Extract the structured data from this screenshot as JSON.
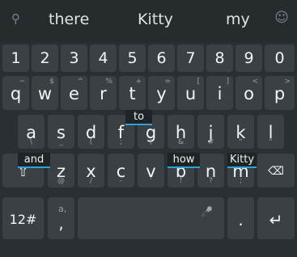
{
  "suggestions": {
    "search_icon": "search-icon",
    "items": [
      "there",
      "Kitty",
      "my"
    ],
    "emoji_icon": "emoji-icon"
  },
  "number_row": [
    {
      "main": "1",
      "alt": ""
    },
    {
      "main": "2",
      "alt": ""
    },
    {
      "main": "3",
      "alt": ""
    },
    {
      "main": "4",
      "alt": ""
    },
    {
      "main": "5",
      "alt": ""
    },
    {
      "main": "6",
      "alt": ""
    },
    {
      "main": "7",
      "alt": ""
    },
    {
      "main": "8",
      "alt": ""
    },
    {
      "main": "9",
      "alt": ""
    },
    {
      "main": "0",
      "alt": ""
    }
  ],
  "row1": [
    {
      "main": "q",
      "alt": "~"
    },
    {
      "main": "w",
      "alt": "$"
    },
    {
      "main": "e",
      "alt": "^"
    },
    {
      "main": "r",
      "alt": "%"
    },
    {
      "main": "t",
      "alt": "+"
    },
    {
      "main": "y",
      "alt": "="
    },
    {
      "main": "u",
      "alt": "["
    },
    {
      "main": "i",
      "alt": "]"
    },
    {
      "main": "o",
      "alt": "<"
    },
    {
      "main": "p",
      "alt": ">"
    }
  ],
  "row2": [
    {
      "main": "a",
      "alt": "\\"
    },
    {
      "main": "s",
      "alt": "_"
    },
    {
      "main": "d",
      "alt": "("
    },
    {
      "main": "f",
      "alt": ";"
    },
    {
      "main": "g",
      "alt": ")"
    },
    {
      "main": "h",
      "alt": "&"
    },
    {
      "main": "j",
      "alt": "#"
    },
    {
      "main": "k",
      "alt": "\""
    },
    {
      "main": "l",
      "alt": "\""
    }
  ],
  "row3": [
    {
      "main": "z",
      "alt": "@"
    },
    {
      "main": "x",
      "alt": "/"
    },
    {
      "main": "c",
      "alt": "-"
    },
    {
      "main": "v",
      "alt": "'"
    },
    {
      "main": "b",
      "alt": "!"
    },
    {
      "main": "n",
      "alt": "?"
    },
    {
      "main": "m",
      "alt": ";"
    }
  ],
  "word_popups": [
    "to",
    "and",
    "how",
    "Kitty"
  ],
  "bottom": {
    "num_switch": "12#",
    "comma_alt": "a,",
    "comma": ",",
    "period": ".",
    "mic_icon": "mic-icon",
    "enter_icon": "enter-icon"
  },
  "colors": {
    "background": "#2a2f33",
    "key": "#3a4044",
    "accent": "#3fc2d9",
    "popup_underline": "#2ea3d6"
  }
}
